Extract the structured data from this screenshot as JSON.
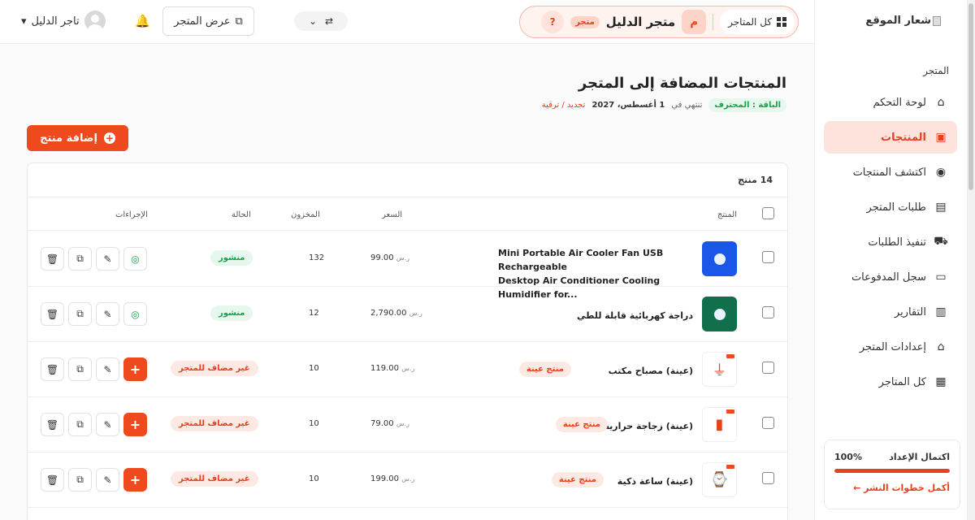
{
  "sidebar": {
    "logo_alt": "شعار الموقع",
    "section": "المتجر",
    "items": [
      {
        "label": "لوحة التحكم",
        "icon": "home-icon",
        "glyph": "⌂",
        "active": false
      },
      {
        "label": "المنتجات",
        "icon": "box-icon",
        "glyph": "▣",
        "active": true
      },
      {
        "label": "اكتشف المنتجات",
        "icon": "compass-icon",
        "glyph": "◉",
        "active": false
      },
      {
        "label": "طلبات المتجر",
        "icon": "clipboard-icon",
        "glyph": "▤",
        "active": false
      },
      {
        "label": "تنفيذ الطلبات",
        "icon": "truck-icon",
        "glyph": "⛟",
        "active": false
      },
      {
        "label": "سجل المدفوعات",
        "icon": "money-icon",
        "glyph": "▭",
        "active": false
      },
      {
        "label": "التقارير",
        "icon": "chart-icon",
        "glyph": "▥",
        "active": false
      },
      {
        "label": "إعدادات المتجر",
        "icon": "storefront-icon",
        "glyph": "⌂",
        "active": false
      },
      {
        "label": "كل المتاجر",
        "icon": "grid-icon",
        "glyph": "▦",
        "active": false
      }
    ],
    "setup": {
      "title": "اكتمال الإعداد",
      "percent_text": "100%",
      "progress": 1.0,
      "link": "أكمل خطوات النشر ←"
    }
  },
  "topbar": {
    "all_stores": "كل المتاجر",
    "store_initial": "م",
    "store_name": "متجر الدليل",
    "store_tag": "متجر",
    "help": "?",
    "switch_arrows": "⇄",
    "switch_chevron": "⌄",
    "view_store": "عرض المتجر",
    "user_name": "تاجر الدليل",
    "user_chevron": "▾"
  },
  "page": {
    "title": "المنتجات المضافة إلى المتجر",
    "plan_badge": "الباقة : المحترف",
    "expires_prefix": "تنتهي في",
    "expires_date": "1 أغسطس، 2027",
    "renew": "تجديد / ترقية",
    "add_product": "إضافة منتج",
    "count": "14 منتج"
  },
  "table": {
    "headers": {
      "product": "المنتج",
      "price": "السعر",
      "stock": "المخزون",
      "status": "الحالة",
      "actions": "الإجراءات"
    },
    "currency": "ر.س",
    "rows": [
      {
        "name_line1": "Mini Portable Air Cooler Fan USB Rechargeable",
        "name_line2": "Desktop Air Conditioner Cooling Humidifier for...",
        "price": "99.00",
        "stock": "132",
        "status": "منشور",
        "status_type": "pub",
        "thumb": "blue",
        "sample": false
      },
      {
        "name_line1": "دراجة كهربائية قابلة للطي",
        "price": "2,790.00",
        "stock": "12",
        "status": "منشور",
        "status_type": "pub",
        "thumb": "green",
        "sample": false
      },
      {
        "name_line1": "(عينة) مصباح مكتب",
        "badge": "منتج عينة",
        "price": "119.00",
        "stock": "10",
        "status": "غير مضاف للمتجر",
        "status_type": "not",
        "thumb": "lamp",
        "sample": true
      },
      {
        "name_line1": "(عينة) زجاجة حرارية",
        "badge": "منتج عينة",
        "price": "79.00",
        "stock": "10",
        "status": "غير مضاف للمتجر",
        "status_type": "not",
        "thumb": "bottle",
        "sample": true
      },
      {
        "name_line1": "(عينة) ساعة ذكية",
        "badge": "منتج عينة",
        "price": "199.00",
        "stock": "10",
        "status": "غير مضاف للمتجر",
        "status_type": "not",
        "thumb": "watch",
        "sample": true
      }
    ]
  }
}
